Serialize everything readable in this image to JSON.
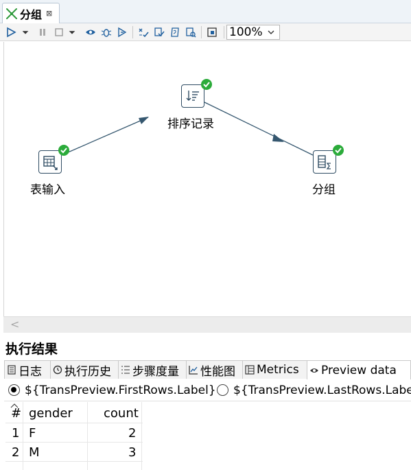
{
  "editor_tab": {
    "title": "分组",
    "close_symbol": "⊠"
  },
  "toolbar": {
    "zoom_value": "100%",
    "icons": [
      "run-icon",
      "dropdown-icon",
      "pause-icon",
      "stop-icon",
      "dropdown-icon",
      "preview-icon",
      "debug-icon",
      "replay-icon",
      "verify-icon",
      "analyze-impact-icon",
      "sql-icon",
      "explore-db-icon",
      "grid-icon"
    ]
  },
  "canvas": {
    "steps": [
      {
        "label": "表输入",
        "icon": "table-input-icon",
        "status": "success"
      },
      {
        "label": "排序记录",
        "icon": "sort-rows-icon",
        "status": "success"
      },
      {
        "label": "分组",
        "icon": "group-by-icon",
        "status": "success"
      }
    ],
    "hops": [
      [
        "表输入",
        "排序记录"
      ],
      [
        "排序记录",
        "分组"
      ]
    ],
    "scroll_left_symbol": "<"
  },
  "results": {
    "title": "执行结果",
    "tabs": [
      {
        "label": "日志",
        "icon": "log-icon"
      },
      {
        "label": "执行历史",
        "icon": "history-icon"
      },
      {
        "label": "步骤度量",
        "icon": "step-metrics-icon"
      },
      {
        "label": "性能图",
        "icon": "performance-icon"
      },
      {
        "label": "Metrics",
        "icon": "metrics-icon"
      },
      {
        "label": "Preview data",
        "icon": "preview-eye-icon",
        "active": true
      }
    ],
    "radio_options": [
      {
        "label": "${TransPreview.FirstRows.Label}",
        "selected": true
      },
      {
        "label": "${TransPreview.LastRows.Label}",
        "selected": false
      }
    ],
    "table": {
      "columns": [
        "#",
        "gender",
        "count"
      ],
      "rows": [
        [
          "1",
          "F",
          "2"
        ],
        [
          "2",
          "M",
          "3"
        ]
      ]
    }
  }
}
